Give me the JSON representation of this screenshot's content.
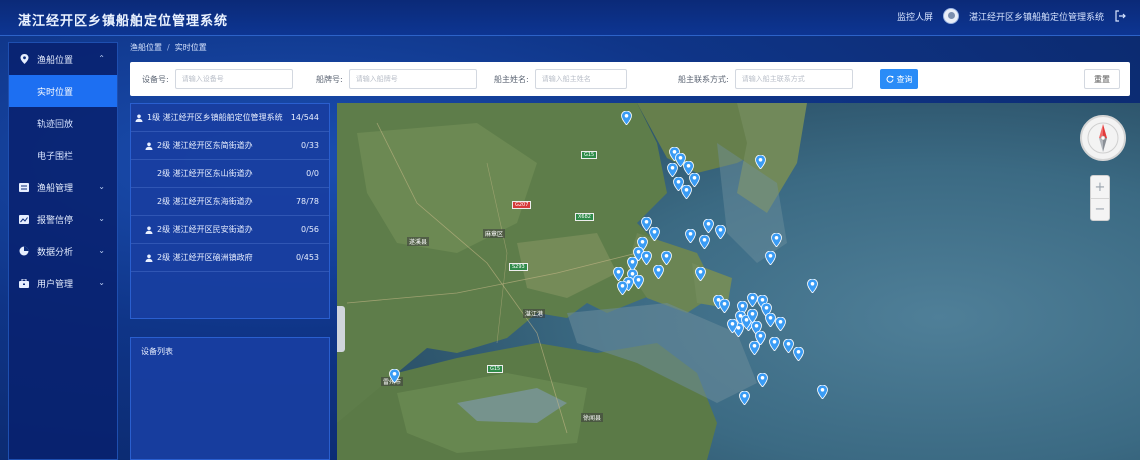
{
  "header": {
    "title": "湛江经开区乡镇船舶定位管理系统",
    "link": "监控人屏",
    "user": "湛江经开区乡镇船舶定位管理系统"
  },
  "sidebar": {
    "groups": [
      {
        "label": "渔船位置",
        "icon": "location-pin-icon",
        "expanded": true,
        "children": [
          {
            "label": "实时位置",
            "active": true
          },
          {
            "label": "轨迹回放",
            "active": false
          },
          {
            "label": "电子围栏",
            "active": false
          }
        ]
      },
      {
        "label": "渔船管理",
        "icon": "list-icon"
      },
      {
        "label": "报警信停",
        "icon": "chart-icon"
      },
      {
        "label": "数据分析",
        "icon": "pie-chart-icon"
      },
      {
        "label": "用户管理",
        "icon": "briefcase-icon"
      }
    ]
  },
  "breadcrumb": {
    "parent": "渔船位置",
    "separator": "/",
    "current": "实时位置"
  },
  "search": {
    "device_label": "设备号:",
    "device_placeholder": "请输入设备号",
    "ship_label": "船牌号:",
    "ship_placeholder": "请输入船牌号",
    "owner_label": "船主姓名:",
    "owner_placeholder": "请输入船主姓名",
    "contact_label": "船主联系方式:",
    "contact_placeholder": "请输入船主联系方式",
    "query_label": "查询",
    "reset_label": "重置"
  },
  "tree": [
    {
      "level": "1级",
      "name": "湛江经开区乡镇船舶定位管理系统",
      "count": "14/544"
    },
    {
      "level": "2级",
      "name": "湛江经开区东简街道办",
      "count": "0/33"
    },
    {
      "level": "2级",
      "name": "湛江经开区东山街道办",
      "count": "0/0"
    },
    {
      "level": "2级",
      "name": "湛江经开区东海街道办",
      "count": "78/78"
    },
    {
      "level": "2级",
      "name": "湛江经开区民安街道办",
      "count": "0/56"
    },
    {
      "level": "2级",
      "name": "湛江经开区硇洲镇政府",
      "count": "0/453"
    }
  ],
  "device_panel": {
    "title": "设备列表"
  },
  "map": {
    "labels": [
      "湛江港",
      "遂溪县",
      "麻章区",
      "徐闻县",
      "雷州市"
    ],
    "marker_color": "#3a9cf5"
  }
}
